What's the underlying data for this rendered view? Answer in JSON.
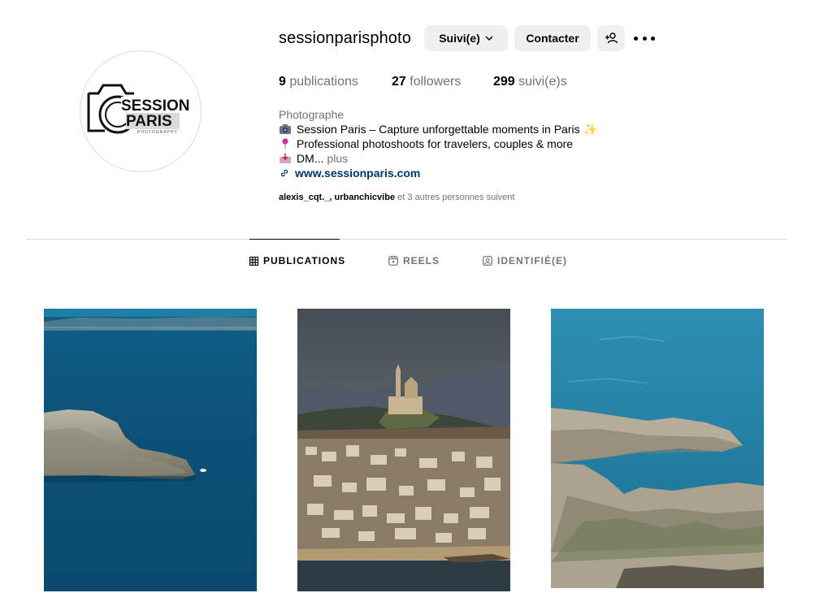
{
  "profile": {
    "username": "sessionparisphoto",
    "logo_text": {
      "line1": "SESSION",
      "line2": "PARIS",
      "line3": "PHOTOGRAPHY"
    }
  },
  "actions": {
    "follow_label": "Suivi(e)",
    "contact_label": "Contacter"
  },
  "stats": {
    "posts_count": "9",
    "posts_label": "publications",
    "followers_count": "27",
    "followers_label": "followers",
    "following_count": "299",
    "following_label": "suivi(e)s"
  },
  "bio": {
    "category": "Photographe",
    "line1": "Session Paris – Capture unforgettable moments in Paris ✨",
    "line2": "Professional photoshoots for travelers, couples & more",
    "line3": "DM...",
    "more": "plus",
    "link": "www.sessionparis.com"
  },
  "followed_by": {
    "names": "alexis_cqt._, urbanchicvibe",
    "rest": "et 3 autres personnes suivent"
  },
  "tabs": [
    {
      "label": "PUBLICATIONS",
      "icon": "grid-icon",
      "active": true
    },
    {
      "label": "REELS",
      "icon": "reels-icon",
      "active": false
    },
    {
      "label": "IDENTIFIÉ(E)",
      "icon": "tagged-icon",
      "active": false
    }
  ],
  "posts": [
    {
      "subject": "island-sea-photo"
    },
    {
      "subject": "city-hill-basilica-photo"
    },
    {
      "subject": "rocky-coast-photo"
    }
  ]
}
